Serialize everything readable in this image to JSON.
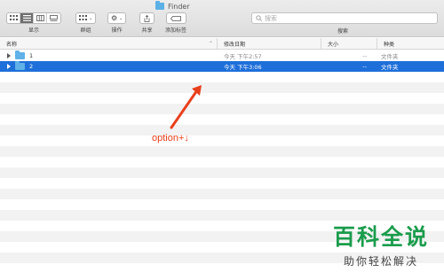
{
  "window": {
    "title": "Finder"
  },
  "toolbar": {
    "view_label": "显示",
    "group_label": "群组",
    "action_label": "操作",
    "share_label": "共享",
    "tag_label": "添加标签"
  },
  "search": {
    "placeholder": "搜索",
    "label": "搜索"
  },
  "columns": {
    "name": "名称",
    "date": "修改日期",
    "size": "大小",
    "kind": "种类"
  },
  "rows": [
    {
      "name": "1",
      "date": "今天 下午2:57",
      "size": "--",
      "kind": "文件夹",
      "selected": false
    },
    {
      "name": "2",
      "date": "今天 下午3:06",
      "size": "--",
      "kind": "文件夹",
      "selected": true
    }
  ],
  "annotation": {
    "text": "option+↓",
    "color": "#e8401c"
  },
  "watermark": {
    "title": "百科全说",
    "subtitle": "助你轻松解决"
  },
  "colors": {
    "selection": "#1e6fd9",
    "folder": "#5fb1e8",
    "watermark_green": "#1a9c4c"
  }
}
